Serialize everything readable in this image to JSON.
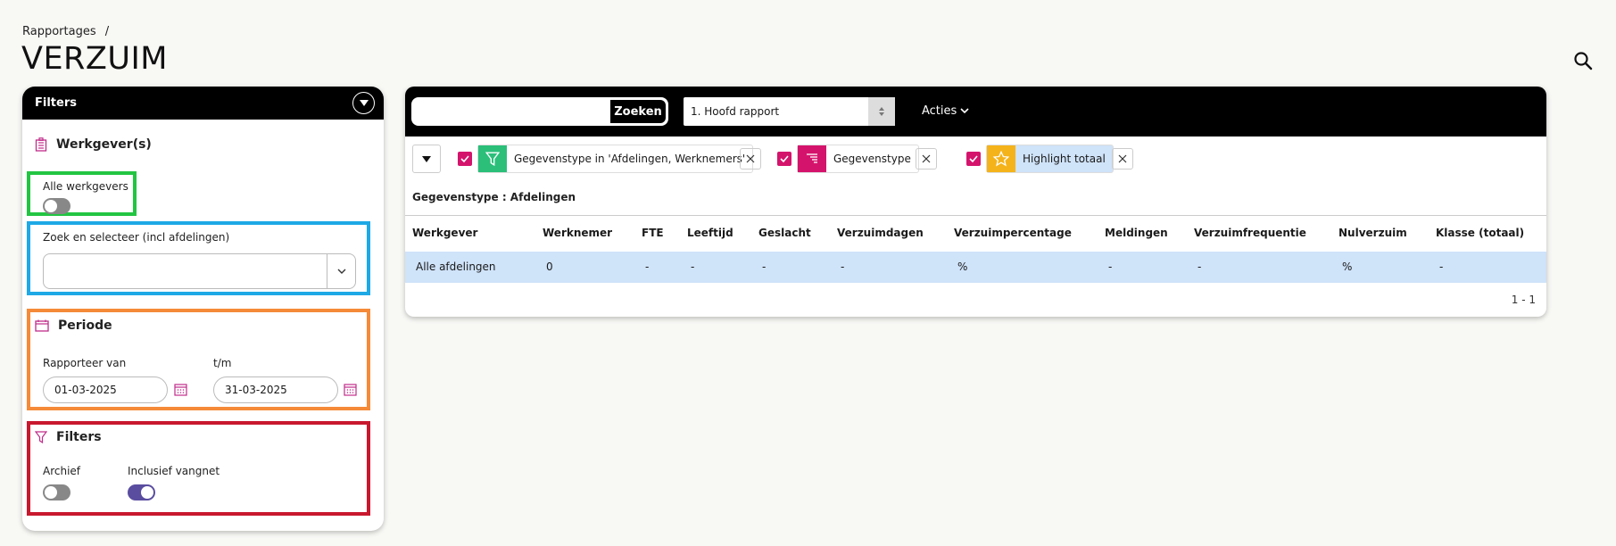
{
  "breadcrumb": {
    "item": "Rapportages",
    "separator": "/"
  },
  "page": {
    "title": "VERZUIM"
  },
  "filters_panel": {
    "title": "Filters",
    "werkgever": {
      "title": "Werkgever(s)",
      "alle_label": "Alle werkgevers",
      "alle_on": false,
      "search_label": "Zoek en selecteer (incl afdelingen)",
      "search_value": ""
    },
    "periode": {
      "title": "Periode",
      "from_label": "Rapporteer van",
      "from_value": "01-03-2025",
      "to_label": "t/m",
      "to_value": "31-03-2025"
    },
    "filters": {
      "title": "Filters",
      "archief_label": "Archief",
      "archief_on": false,
      "vangnet_label": "Inclusief vangnet",
      "vangnet_on": true
    }
  },
  "toolbar": {
    "search_placeholder": "",
    "search_button": "Zoeken",
    "report_select": "1. Hoofd rapport",
    "acties": "Acties"
  },
  "chips": [
    {
      "label": "Gegevenstype in 'Afdelingen, Werknemers'",
      "icon": "funnel-icon",
      "color": "#2bbf7a"
    },
    {
      "label": "Gegevenstype",
      "icon": "sort-lines-icon",
      "color": "#d4146c"
    },
    {
      "label": "Highlight totaal",
      "icon": "star-icon",
      "color": "#f5b31b"
    }
  ],
  "group_label": "Gegevenstype : Afdelingen",
  "table": {
    "headers": [
      "Werkgever",
      "Werknemer",
      "FTE",
      "Leeftijd",
      "Geslacht",
      "Verzuimdagen",
      "Verzuimpercentage",
      "Meldingen",
      "Verzuimfrequentie",
      "Nulverzuim",
      "Klasse (totaal)"
    ],
    "rows": [
      [
        "Alle afdelingen",
        "0",
        "-",
        "-",
        "-",
        "-",
        "%",
        "-",
        "-",
        "%",
        "-"
      ]
    ]
  },
  "pager": "1 - 1",
  "colors": {
    "accent": "#d4146c",
    "toggle_on": "#5a4da0",
    "row_highlight": "#cfe3f9"
  }
}
